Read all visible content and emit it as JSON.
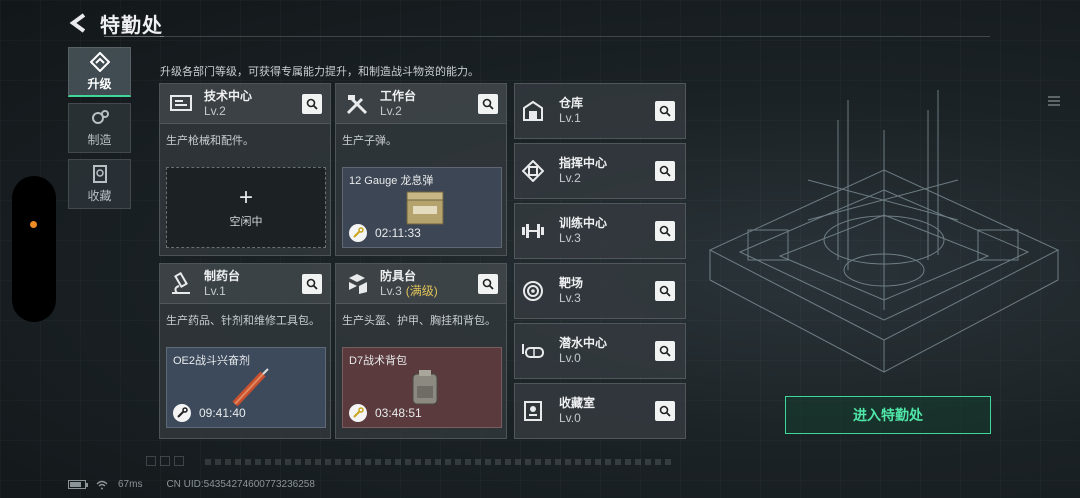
{
  "header": {
    "title": "特勤处"
  },
  "tabs": [
    {
      "label": "升级",
      "icon": "upgrade-icon",
      "active": true
    },
    {
      "label": "制造",
      "icon": "gears-icon",
      "active": false
    },
    {
      "label": "收藏",
      "icon": "collection-icon",
      "active": false
    }
  ],
  "description": "升级各部门等级，可获得专属能力提升，和制造战斗物资的能力。",
  "departments": [
    {
      "name": "技术中心",
      "level": "Lv.2",
      "desc": "生产枪械和配件。",
      "icon": "tech-center-icon",
      "status": "空闲中"
    },
    {
      "name": "工作台",
      "level": "Lv.2",
      "desc": "生产子弹。",
      "icon": "workbench-icon",
      "item": "12 Gauge 龙息弹",
      "timer": "02:11:33"
    },
    {
      "name": "制药台",
      "level": "Lv.1",
      "desc": "生产药品、针剂和维修工具包。",
      "icon": "pharmacy-icon",
      "item": "OE2战斗兴奋剂",
      "timer": "09:41:40"
    },
    {
      "name": "防具台",
      "level": "Lv.3",
      "level_note": "(满级)",
      "desc": "生产头盔、护甲、胸挂和背包。",
      "icon": "armor-bench-icon",
      "item": "D7战术背包",
      "timer": "03:48:51"
    }
  ],
  "facilities": [
    {
      "name": "仓库",
      "level": "Lv.1",
      "icon": "warehouse-icon"
    },
    {
      "name": "指挥中心",
      "level": "Lv.2",
      "icon": "command-center-icon"
    },
    {
      "name": "训练中心",
      "level": "Lv.3",
      "icon": "dumbbell-icon"
    },
    {
      "name": "靶场",
      "level": "Lv.3",
      "icon": "target-icon"
    },
    {
      "name": "潜水中心",
      "level": "Lv.0",
      "icon": "diving-icon"
    },
    {
      "name": "收藏室",
      "level": "Lv.0",
      "icon": "collection-room-icon"
    }
  ],
  "enter_button": "进入特勤处",
  "footer": {
    "ping": "67ms",
    "uid": "CN UID:54354274600773236258"
  },
  "colors": {
    "accent": "#3fd89a",
    "max_level": "#e2c35a",
    "orange_dot": "#f08a24"
  }
}
